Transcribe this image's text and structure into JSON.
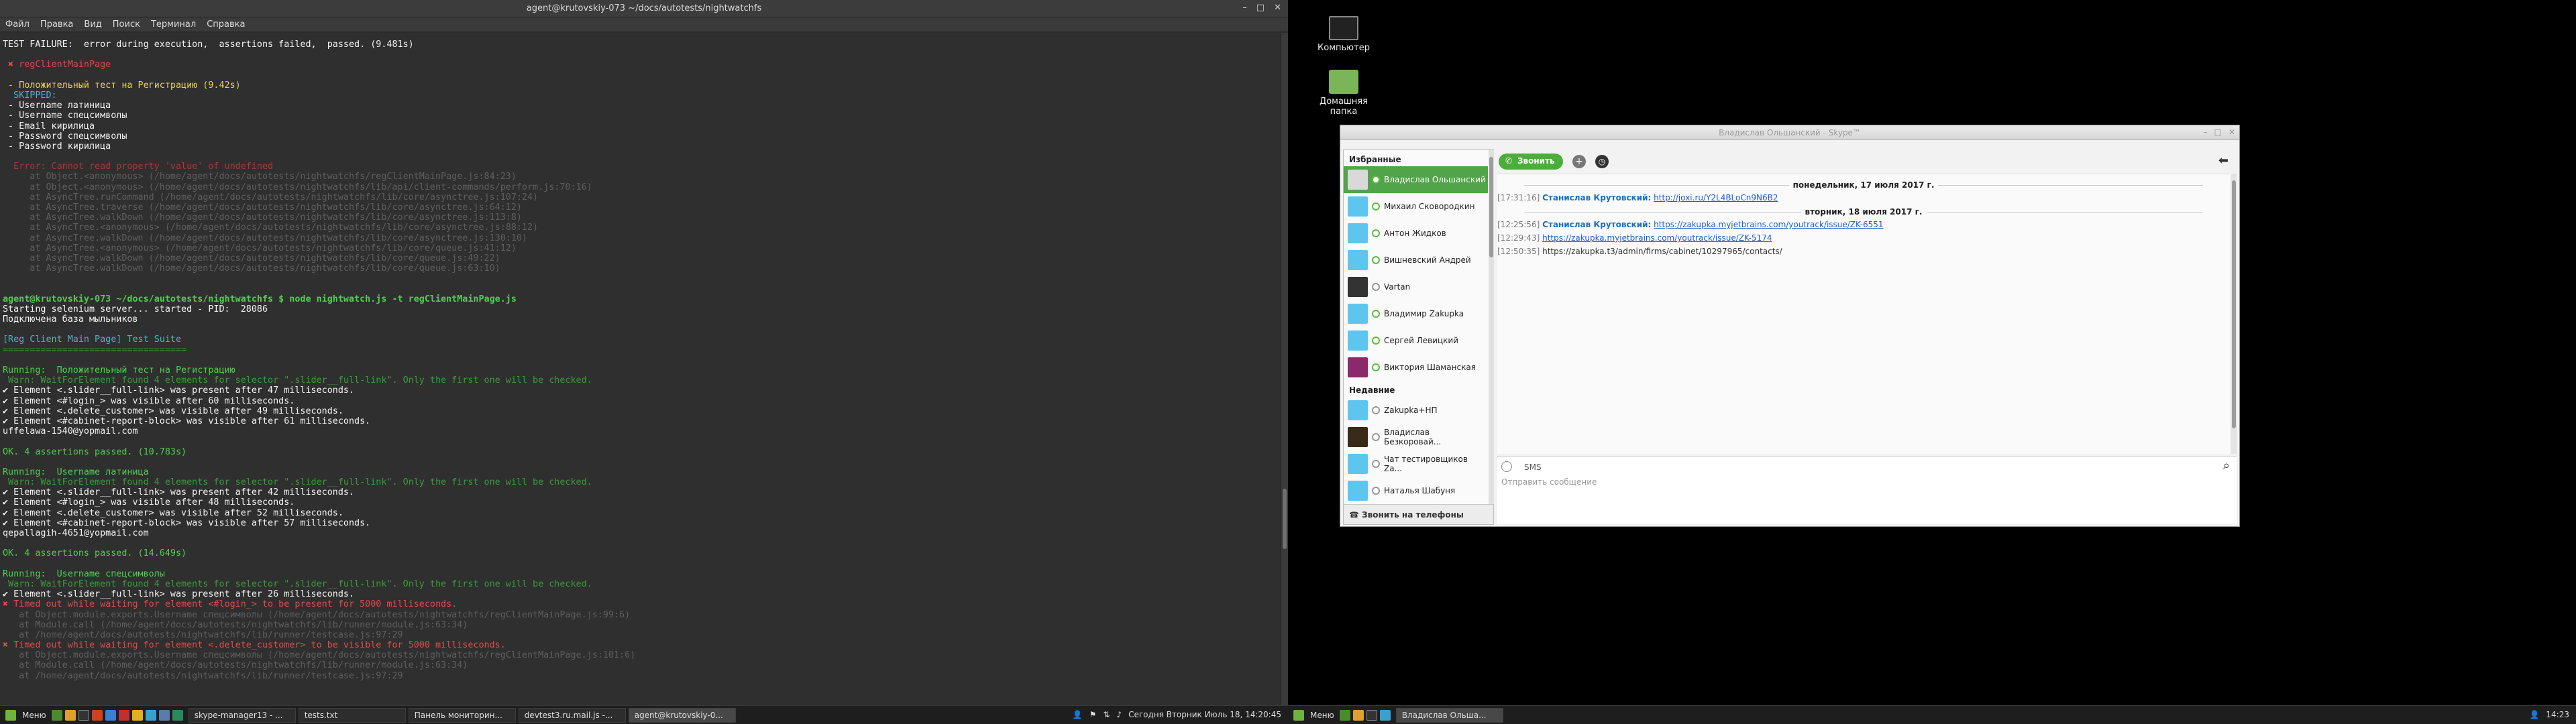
{
  "terminal": {
    "title": "agent@krutovskiy-073 ~/docs/autotests/nightwatchfs",
    "menu": [
      "Файл",
      "Правка",
      "Вид",
      "Поиск",
      "Терминал",
      "Справка"
    ],
    "lines": [
      {
        "t": "TEST FAILURE:  error during execution,  assertions failed,  passed. (9.481s)",
        "c": "wht"
      },
      {
        "t": "",
        "c": ""
      },
      {
        "t": " ✖ regClientMainPage",
        "c": "red"
      },
      {
        "t": "",
        "c": ""
      },
      {
        "t": " - Положительный тест на Регистрацию (9.42s)",
        "c": "yel"
      },
      {
        "t": "  SKIPPED:",
        "c": "cyan"
      },
      {
        "t": " - Username латиница",
        "c": "wht"
      },
      {
        "t": " - Username спецсимволы",
        "c": "wht"
      },
      {
        "t": " - Email кирилица",
        "c": "wht"
      },
      {
        "t": " - Password спецсимволы",
        "c": "wht"
      },
      {
        "t": " - Password кирилица",
        "c": "wht"
      },
      {
        "t": "",
        "c": ""
      },
      {
        "t": "  Error: Cannot read property 'value' of undefined",
        "c": "dred"
      },
      {
        "t": "     at Object.<anonymous> (/home/agent/docs/autotests/nightwatchfs/regClientMainPage.js:84:23)",
        "c": "dim"
      },
      {
        "t": "     at Object.<anonymous> (/home/agent/docs/autotests/nightwatchfs/lib/api/client-commands/perform.js:70:16)",
        "c": "dim"
      },
      {
        "t": "     at AsyncTree.runCommand (/home/agent/docs/autotests/nightwatchfs/lib/core/asynctree.js:107:24)",
        "c": "dim"
      },
      {
        "t": "     at AsyncTree.traverse (/home/agent/docs/autotests/nightwatchfs/lib/core/asynctree.js:64:12)",
        "c": "dim"
      },
      {
        "t": "     at AsyncTree.walkDown (/home/agent/docs/autotests/nightwatchfs/lib/core/asynctree.js:113:8)",
        "c": "dim"
      },
      {
        "t": "     at AsyncTree.<anonymous> (/home/agent/docs/autotests/nightwatchfs/lib/core/asynctree.js:88:12)",
        "c": "dim"
      },
      {
        "t": "     at AsyncTree.walkDown (/home/agent/docs/autotests/nightwatchfs/lib/core/asynctree.js:130:10)",
        "c": "dim"
      },
      {
        "t": "     at AsyncTree.<anonymous> (/home/agent/docs/autotests/nightwatchfs/lib/core/queue.js:41:12)",
        "c": "dim"
      },
      {
        "t": "     at AsyncTree.walkDown (/home/agent/docs/autotests/nightwatchfs/lib/core/queue.js:49:22)",
        "c": "dim"
      },
      {
        "t": "     at AsyncTree.walkDown (/home/agent/docs/autotests/nightwatchfs/lib/core/queue.js:63:10)",
        "c": "dim"
      },
      {
        "t": "",
        "c": ""
      },
      {
        "t": "",
        "c": ""
      },
      {
        "t": "agent@krutovskiy-073 ~/docs/autotests/nightwatchfs $ node nightwatch.js -t regClientMainPage.js",
        "c": "prompt"
      },
      {
        "t": "Starting selenium server... started - PID:  28086",
        "c": "wht"
      },
      {
        "t": "Подключена база мыльников",
        "c": "wht"
      },
      {
        "t": "",
        "c": ""
      },
      {
        "t": "[Reg Client Main Page] Test Suite",
        "c": "cyan"
      },
      {
        "t": "==================================",
        "c": "dgrn"
      },
      {
        "t": "",
        "c": ""
      },
      {
        "t": "Running:  Положительный тест на Регистрацию",
        "c": "grn"
      },
      {
        "t": " Warn: WaitForElement found 4 elements for selector \".slider__full-link\". Only the first one will be checked.",
        "c": "dgrn"
      },
      {
        "t": "✔ Element <.slider__full-link> was present after 47 milliseconds.",
        "c": "wht"
      },
      {
        "t": "✔ Element <#login_> was visible after 60 milliseconds.",
        "c": "wht"
      },
      {
        "t": "✔ Element <.delete_customer> was visible after 49 milliseconds.",
        "c": "wht"
      },
      {
        "t": "✔ Element <#cabinet-report-block> was visible after 61 milliseconds.",
        "c": "wht"
      },
      {
        "t": "uffelawa-1540@yopmail.com",
        "c": "wht"
      },
      {
        "t": "",
        "c": ""
      },
      {
        "t": "OK. 4 assertions passed. (10.783s)",
        "c": "grn"
      },
      {
        "t": "",
        "c": ""
      },
      {
        "t": "Running:  Username латиница",
        "c": "grn"
      },
      {
        "t": " Warn: WaitForElement found 4 elements for selector \".slider__full-link\". Only the first one will be checked.",
        "c": "dgrn"
      },
      {
        "t": "✔ Element <.slider__full-link> was present after 42 milliseconds.",
        "c": "wht"
      },
      {
        "t": "✔ Element <#login_> was visible after 48 milliseconds.",
        "c": "wht"
      },
      {
        "t": "✔ Element <.delete_customer> was visible after 52 milliseconds.",
        "c": "wht"
      },
      {
        "t": "✔ Element <#cabinet-report-block> was visible after 57 milliseconds.",
        "c": "wht"
      },
      {
        "t": "qepallagih-4651@yopmail.com",
        "c": "wht"
      },
      {
        "t": "",
        "c": ""
      },
      {
        "t": "OK. 4 assertions passed. (14.649s)",
        "c": "grn"
      },
      {
        "t": "",
        "c": ""
      },
      {
        "t": "Running:  Username спецсимволы",
        "c": "grn"
      },
      {
        "t": " Warn: WaitForElement found 4 elements for selector \".slider__full-link\". Only the first one will be checked.",
        "c": "dgrn"
      },
      {
        "t": "✔ Element <.slider__full-link> was present after 26 milliseconds.",
        "c": "wht"
      },
      {
        "t": "✖ Timed out while waiting for element <#login_> to be present for 5000 milliseconds.",
        "c": "red"
      },
      {
        "t": "   at Object.module.exports.Username спецсимволы (/home/agent/docs/autotests/nightwatchfs/regClientMainPage.js:99:6)",
        "c": "dim"
      },
      {
        "t": "   at Module.call (/home/agent/docs/autotests/nightwatchfs/lib/runner/module.js:63:34)",
        "c": "dim"
      },
      {
        "t": "   at /home/agent/docs/autotests/nightwatchfs/lib/runner/testcase.js:97:29",
        "c": "dim"
      },
      {
        "t": "✖ Timed out while waiting for element <.delete_customer> to be visible for 5000 milliseconds.",
        "c": "red"
      },
      {
        "t": "   at Object.module.exports.Username спецсимволы (/home/agent/docs/autotests/nightwatchfs/regClientMainPage.js:101:6)",
        "c": "dim"
      },
      {
        "t": "   at Module.call (/home/agent/docs/autotests/nightwatchfs/lib/runner/module.js:63:34)",
        "c": "dim"
      },
      {
        "t": "   at /home/agent/docs/autotests/nightwatchfs/lib/runner/testcase.js:97:29",
        "c": "dim"
      }
    ]
  },
  "taskbar_left": {
    "menu_label": "Меню",
    "windows": [
      "skype-manager13 - ...",
      "tests.txt",
      "Панель мониторин...",
      "devtest3.ru.mail.js -...",
      "agent@krutovskiy-0..."
    ],
    "clock": "Сегодня Вторник Июль 18, 14:20:45"
  },
  "desktop": {
    "icons": [
      "Компьютер",
      "Домашняя папка"
    ]
  },
  "skype": {
    "title": "Владислав Ольшанский - Skype™",
    "favorites_label": "Избранные",
    "recent_label": "Недавние",
    "call_label": "Звонить",
    "call_phones_label": "Звонить на телефоны",
    "sms_label": "SMS",
    "message_placeholder": "Отправить сообщение",
    "contacts": [
      {
        "name": "Владислав Ольшанский",
        "selected": true
      },
      {
        "name": "Михаил Сковородкин"
      },
      {
        "name": "Антон Жидков"
      },
      {
        "name": "Вишневский Андрей"
      },
      {
        "name": "Vartan"
      },
      {
        "name": "Владимир Zakupka"
      },
      {
        "name": "Сергей Левицкий"
      },
      {
        "name": "Виктория Шаманская"
      }
    ],
    "recent": [
      {
        "name": "Zakupka+НП"
      },
      {
        "name": "Владислав Безкоровай..."
      },
      {
        "name": "Чат тестировщиков Za..."
      },
      {
        "name": "Наталья Шабуня"
      }
    ],
    "chat": {
      "date1": "понедельник, 17 июля 2017 г.",
      "date2": "вторник, 18 июля 2017 г.",
      "messages": [
        {
          "time": "[17:31:16]",
          "name": "Станислав Крутовский:",
          "text": "http://joxi.ru/Y2L4BLoCn9N6B2"
        },
        {
          "time": "[12:25:56]",
          "name": "Станислав Крутовский:",
          "text": "https://zakupka.myjetbrains.com/youtrack/issue/ZK-6551"
        },
        {
          "time": "[12:29:43]",
          "name": "",
          "text": "https://zakupka.myjetbrains.com/youtrack/issue/ZK-5174"
        },
        {
          "time": "[12:50:35]",
          "name": "",
          "text": "https://zakupka.t3/admin/firms/cabinet/10297965/contacts/"
        }
      ]
    }
  },
  "taskbar_right": {
    "menu_label": "Меню",
    "windows": [
      "Владислав Ольша..."
    ],
    "clock": "14:23"
  }
}
